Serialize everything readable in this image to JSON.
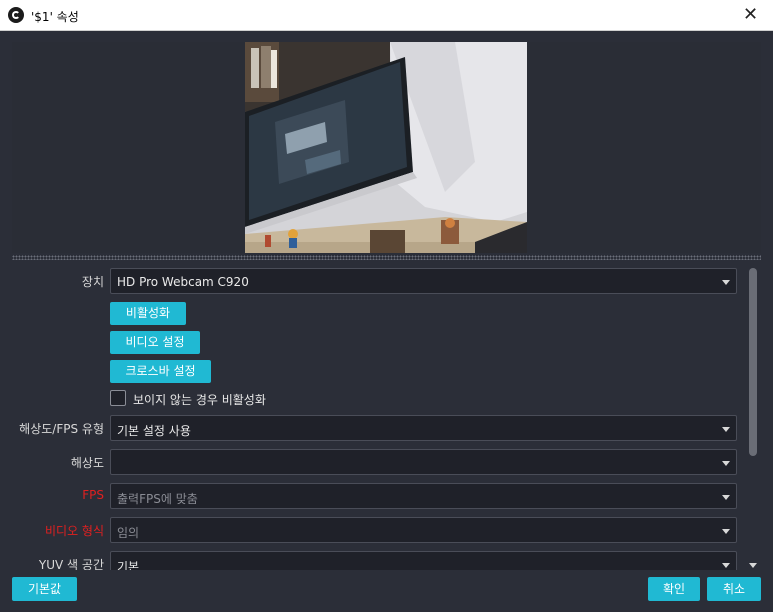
{
  "window": {
    "title": "'$1' 속성",
    "close_glyph": "✕"
  },
  "properties": {
    "device_label": "장치",
    "device_value": "HD Pro Webcam C920",
    "deactivate_button": "비활성화",
    "video_settings_button": "비디오 설정",
    "crossbar_settings_button": "크로스바 설정",
    "hide_checkbox_label": "보이지 않는 경우 비활성화",
    "hide_checkbox_checked": false,
    "res_fps_type_label": "해상도/FPS 유형",
    "res_fps_type_value": "기본 설정 사용",
    "resolution_label": "해상도",
    "resolution_value": "",
    "fps_label": "FPS",
    "fps_value": "출력FPS에 맞춤",
    "video_format_label": "비디오 형식",
    "video_format_value": "임의",
    "yuv_label": "YUV 색 공간",
    "yuv_value": "기본"
  },
  "footer": {
    "defaults_button": "기본값",
    "ok_button": "확인",
    "cancel_button": "취소"
  },
  "colors": {
    "accent": "#20b9d3",
    "warning_label": "#e02020",
    "background": "#2b2e38"
  }
}
